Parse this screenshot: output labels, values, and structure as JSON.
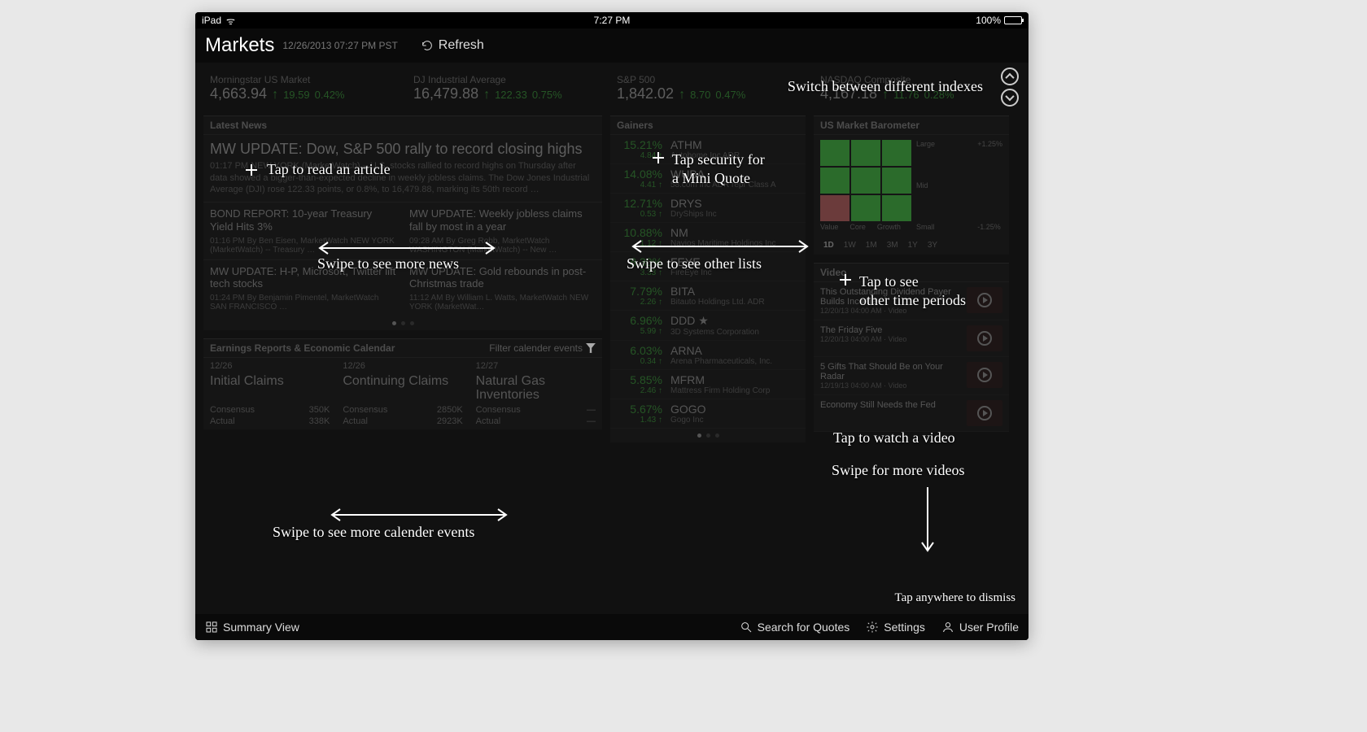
{
  "statusbar": {
    "device": "iPad",
    "time": "7:27 PM",
    "battery": "100%"
  },
  "toolbar": {
    "title": "Markets",
    "subtitle": "12/26/2013 07:27 PM PST",
    "refresh": "Refresh"
  },
  "indexes": [
    {
      "name": "Morningstar US Market",
      "value": "4,663.94",
      "delta": "19.59",
      "pct": "0.42%"
    },
    {
      "name": "DJ Industrial Average",
      "value": "16,479.88",
      "delta": "122.33",
      "pct": "0.75%"
    },
    {
      "name": "S&P 500",
      "value": "1,842.02",
      "delta": "8.70",
      "pct": "0.47%"
    },
    {
      "name": "NASDAQ Composite",
      "value": "4,167.18",
      "delta": "11.76",
      "pct": "0.28%"
    }
  ],
  "news": {
    "header": "Latest News",
    "main": {
      "title": "MW UPDATE: Dow, S&P 500 rally to record closing highs",
      "byline": "01:17 PM NEW YORK (MarketWatch) – U.S. stocks rallied to record highs on Thursday after",
      "excerpt": "data showed a bigger-than-expected decline in weekly jobless claims. The Dow Jones Industrial Average (DJI) rose 122.33 points, or 0.8%, to 16,479.88, marking its 50th record …"
    },
    "items": [
      {
        "title": "BOND REPORT: 10-year Treasury Yield Hits 3%",
        "byline": "01:16 PM By Ben Eisen, MarketWatch   NEW YORK (MarketWatch) -- Treasury …"
      },
      {
        "title": "MW UPDATE: Weekly jobless claims fall by most in a year",
        "byline": "09:28 AM By Greg Robb, MarketWatch   WASHINGTON (MarketWatch) -- New …"
      },
      {
        "title": "MW UPDATE: H-P, Microsoft, Twitter lift tech stocks",
        "byline": "01:24 PM By Benjamin Pimentel, MarketWatch   SAN FRANCISCO …"
      },
      {
        "title": "MW UPDATE: Gold rebounds in post-Christmas trade",
        "byline": "11:12 AM By William L. Watts, MarketWatch   NEW YORK (MarketWat…"
      }
    ]
  },
  "calendar": {
    "header": "Earnings Reports & Economic Calendar",
    "filter": "Filter calender events",
    "columns": [
      {
        "date": "12/26",
        "event": "Initial Claims",
        "consensus_label": "Consensus",
        "consensus": "350K",
        "actual_label": "Actual",
        "actual": "338K"
      },
      {
        "date": "12/26",
        "event": "Continuing Claims",
        "consensus_label": "Consensus",
        "consensus": "2850K",
        "actual_label": "Actual",
        "actual": "2923K"
      },
      {
        "date": "12/27",
        "event": "Natural Gas Inventories",
        "consensus_label": "Consensus",
        "consensus": "—",
        "actual_label": "Actual",
        "actual": "—"
      }
    ]
  },
  "gainers": {
    "header": "Gainers",
    "items": [
      {
        "pct": "15.21%",
        "sub": "4.84 ↑",
        "ticker": "ATHM",
        "company": "Autohome Inc ADR"
      },
      {
        "pct": "14.08%",
        "sub": "4.41 ↑",
        "ticker": "WUBA",
        "company": "58.com Inc ADR repr Class A"
      },
      {
        "pct": "12.71%",
        "sub": "0.53 ↑",
        "ticker": "DRYS",
        "company": "DryShips Inc"
      },
      {
        "pct": "10.88%",
        "sub": "1.12 ↑",
        "ticker": "NM",
        "company": "Navios Maritime Holdings Inc"
      },
      {
        "pct": "8.30%",
        "sub": "3.33 ↑",
        "ticker": "FEYE",
        "company": "FireEye Inc"
      },
      {
        "pct": "7.79%",
        "sub": "2.26 ↑",
        "ticker": "BITA",
        "company": "Bitauto Holdings Ltd. ADR"
      },
      {
        "pct": "6.96%",
        "sub": "5.99 ↑",
        "ticker": "DDD ★",
        "company": "3D Systems Corporation"
      },
      {
        "pct": "6.03%",
        "sub": "0.34 ↑",
        "ticker": "ARNA",
        "company": "Arena Pharmaceuticals, Inc."
      },
      {
        "pct": "5.85%",
        "sub": "2.46 ↑",
        "ticker": "MFRM",
        "company": "Mattress Firm Holding Corp"
      },
      {
        "pct": "5.67%",
        "sub": "1.43 ↑",
        "ticker": "GOGO",
        "company": "Gogo Inc"
      }
    ]
  },
  "barometer": {
    "header": "US Market Barometer",
    "rows": [
      "Large",
      "Mid",
      "Small"
    ],
    "cols": [
      "Value",
      "Core",
      "Growth"
    ],
    "scale_top": "+1.25%",
    "scale_bot": "-1.25%",
    "time": [
      "1D",
      "1W",
      "1M",
      "3M",
      "1Y",
      "3Y"
    ]
  },
  "videos": {
    "header": "Video",
    "items": [
      {
        "title": "This Outstanding Dividend Payer Builds Income",
        "meta": "12/20/13 04:00 AM · Video"
      },
      {
        "title": "The Friday Five",
        "meta": "12/20/13 04:00 AM · Video"
      },
      {
        "title": "5 Gifts That Should Be on Your Radar",
        "meta": "12/19/13 04:00 AM · Video"
      },
      {
        "title": "Economy Still Needs the Fed",
        "meta": ""
      }
    ]
  },
  "bottombar": {
    "summary": "Summary View",
    "search": "Search for Quotes",
    "settings": "Settings",
    "profile": "User Profile"
  },
  "hints": {
    "switch_indexes": "Switch between different indexes",
    "tap_article": "Tap to read an article",
    "swipe_news": "Swipe to see more news",
    "tap_security": "Tap security for\na Mini Quote",
    "swipe_lists": "Swipe to see other lists",
    "tap_time": "Tap to see\nother time periods",
    "swipe_cal": "Swipe to see more calender events",
    "tap_video": "Tap to watch a video",
    "swipe_video": "Swipe for more videos",
    "dismiss": "Tap anywhere to dismiss"
  }
}
